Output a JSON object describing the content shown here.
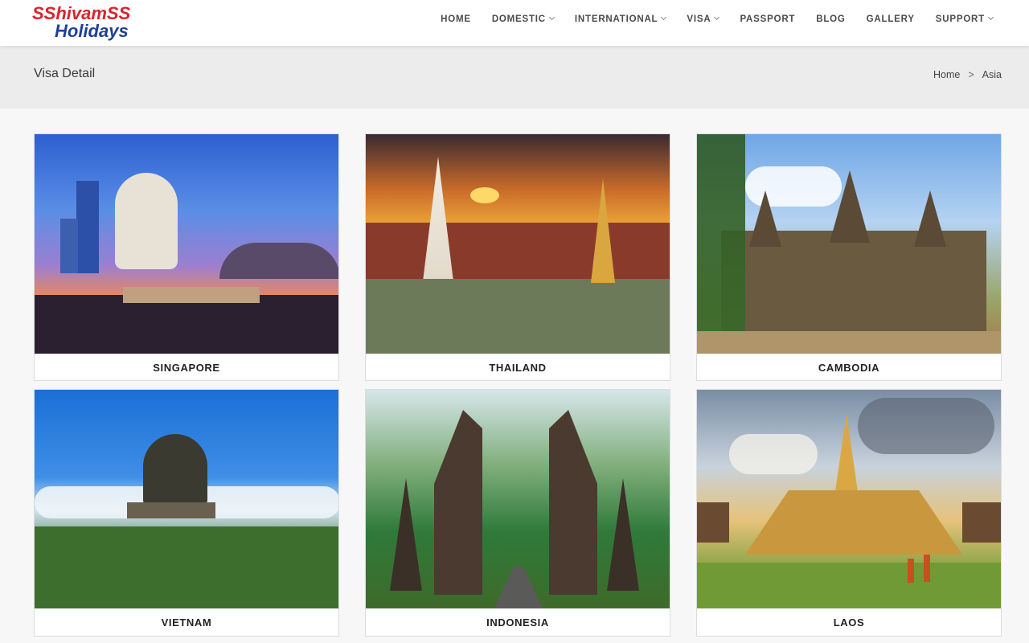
{
  "brand": {
    "line1": "SShivamSS",
    "line2": "Holidays"
  },
  "nav": [
    {
      "label": "HOME",
      "dropdown": false
    },
    {
      "label": "DOMESTIC",
      "dropdown": true
    },
    {
      "label": "INTERNATIONAL",
      "dropdown": true
    },
    {
      "label": "VISA",
      "dropdown": true
    },
    {
      "label": "PASSPORT",
      "dropdown": false
    },
    {
      "label": "BLOG",
      "dropdown": false
    },
    {
      "label": "GALLERY",
      "dropdown": false
    },
    {
      "label": "SUPPORT",
      "dropdown": true
    }
  ],
  "page": {
    "title": "Visa Detail"
  },
  "breadcrumb": {
    "home": "Home",
    "separator": ">",
    "current": "Asia"
  },
  "countries": [
    {
      "name": "SINGAPORE"
    },
    {
      "name": "THAILAND"
    },
    {
      "name": "CAMBODIA"
    },
    {
      "name": "VIETNAM"
    },
    {
      "name": "INDONESIA"
    },
    {
      "name": "LAOS"
    }
  ],
  "colors": {
    "brand_red": "#d9232d",
    "brand_blue": "#1f3f95",
    "accent_yellow": "#f5b21b"
  }
}
